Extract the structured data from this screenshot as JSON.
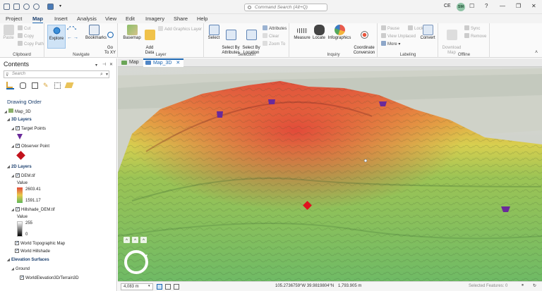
{
  "window": {
    "command_search": "Command Search (Alt+Q)",
    "user_initials": "CE",
    "avatar_initials": "SM",
    "help": "?",
    "minimize": "—",
    "restore": "❐",
    "close": "✕"
  },
  "ribbon_tabs": [
    "Project",
    "Map",
    "Insert",
    "Analysis",
    "View",
    "Edit",
    "Imagery",
    "Share",
    "Help"
  ],
  "active_tab": "Map",
  "ribbon": {
    "clipboard": {
      "label": "Clipboard",
      "paste": "Paste",
      "cut": "Cut",
      "copy": "Copy",
      "copy_path": "Copy Path"
    },
    "navigate": {
      "label": "Navigate",
      "explore": "Explore",
      "bookmarks": "Bookmarks",
      "go_to_xy": "Go\nTo XY"
    },
    "layer": {
      "label": "Layer",
      "basemap": "Basemap",
      "add_data": "Add\nData",
      "add_graphics": "Add Graphics Layer"
    },
    "selection": {
      "label": "Selection",
      "select": "Select",
      "by_attributes": "Select By\nAttributes",
      "by_location": "Select By\nLocation",
      "attributes": "Attributes",
      "clear": "Clear",
      "zoom_to": "Zoom To"
    },
    "inquiry": {
      "label": "Inquiry",
      "measure": "Measure",
      "locate": "Locate",
      "infographics": "Infographics",
      "coordinate_conversion": "Coordinate\nConversion"
    },
    "labeling": {
      "label": "Labeling",
      "pause": "Pause",
      "lock": "Lock",
      "view_unplaced": "View Unplaced",
      "more": "More",
      "convert": "Convert"
    },
    "offline": {
      "label": "Offline",
      "download_map": "Download\nMap",
      "sync": "Sync",
      "remove": "Remove"
    }
  },
  "contents": {
    "title": "Contents",
    "search_placeholder": "Search",
    "drawing_order": "Drawing Order",
    "map_name": "Map_3D",
    "group_3d": "3D Layers",
    "target_points": "Target Points",
    "observer_point": "Observer Point",
    "group_2d": "2D Layers",
    "dem": "DEM.tif",
    "value_label": "Value",
    "dem_max": "2603.41",
    "dem_min": "1591.17",
    "hillshade": "Hillshade_DEM.tif",
    "hs_value_label": "Value",
    "hs_max": "255",
    "hs_min": "0",
    "world_topo": "World Topographic Map",
    "world_hillshade": "World Hillshade",
    "elevation_surfaces": "Elevation Surfaces",
    "ground": "Ground",
    "terrain": "WorldElevation3D/Terrain3D"
  },
  "view_tabs": [
    {
      "label": "Map",
      "active": false
    },
    {
      "label": "Map_3D",
      "active": true
    }
  ],
  "status": {
    "scale": "4,083 m",
    "coordinates": "105.2736759°W 39.9819804°N",
    "elevation": "1,793.905 m",
    "selected": "Selected Features: 0"
  },
  "colors": {
    "accent": "#1b66b1",
    "dem_high": "#e24a3a",
    "dem_mid": "#e8c94a",
    "dem_low": "#5fb85a",
    "target_point": "#6a2a9a",
    "observer_point": "#e0121e"
  }
}
